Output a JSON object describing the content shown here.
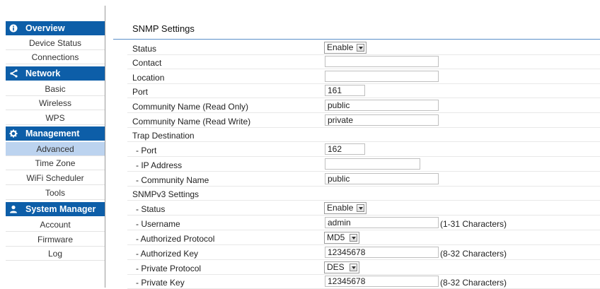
{
  "sidebar": {
    "sections": [
      {
        "title": "Overview",
        "icon": "info-icon",
        "items": [
          "Device Status",
          "Connections"
        ]
      },
      {
        "title": "Network",
        "icon": "share-icon",
        "items": [
          "Basic",
          "Wireless",
          "WPS"
        ]
      },
      {
        "title": "Management",
        "icon": "gear-icon",
        "items": [
          "Advanced",
          "Time Zone",
          "WiFi Scheduler",
          "Tools"
        ]
      },
      {
        "title": "System Manager",
        "icon": "user-icon",
        "items": [
          "Account",
          "Firmware",
          "Log"
        ]
      }
    ],
    "active_item": "Advanced"
  },
  "main": {
    "title": "SNMP Settings",
    "rows": {
      "status": {
        "label": "Status",
        "value": "Enable"
      },
      "contact": {
        "label": "Contact",
        "value": ""
      },
      "location": {
        "label": "Location",
        "value": ""
      },
      "port": {
        "label": "Port",
        "value": "161"
      },
      "community_ro": {
        "label": "Community Name (Read Only)",
        "value": "public"
      },
      "community_rw": {
        "label": "Community Name (Read Write)",
        "value": "private"
      },
      "trap_header": {
        "label": "Trap Destination"
      },
      "trap_port": {
        "label": "- Port",
        "value": "162"
      },
      "trap_ip": {
        "label": "- IP Address",
        "value": ""
      },
      "trap_community": {
        "label": "- Community Name",
        "value": "public"
      },
      "v3_header": {
        "label": "SNMPv3 Settings"
      },
      "v3_status": {
        "label": "- Status",
        "value": "Enable"
      },
      "v3_username": {
        "label": "- Username",
        "value": "admin",
        "hint": "(1-31 Characters)"
      },
      "v3_auth_protocol": {
        "label": "- Authorized Protocol",
        "value": "MD5"
      },
      "v3_auth_key": {
        "label": "- Authorized Key",
        "value": "12345678",
        "hint": "(8-32 Characters)"
      },
      "v3_priv_protocol": {
        "label": "- Private Protocol",
        "value": "DES"
      },
      "v3_priv_key": {
        "label": "- Private Key",
        "value": "12345678",
        "hint": "(8-32 Characters)"
      }
    }
  },
  "colors": {
    "nav_header": "#0d5ea8",
    "nav_active": "#bcd3ef",
    "title_rule": "#5b8fc8"
  }
}
